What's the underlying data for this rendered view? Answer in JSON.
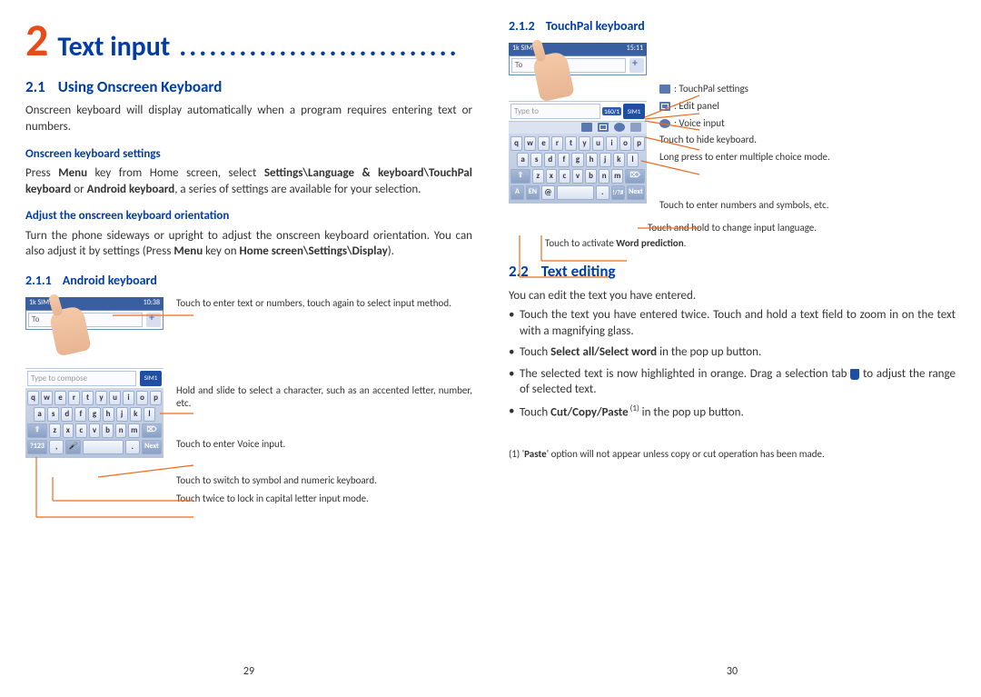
{
  "chapter": {
    "num": "2",
    "name": "Text input",
    "dots": "............................"
  },
  "s21": {
    "num": "2.1",
    "title": "Using Onscreen Keyboard",
    "p1": "Onscreen keyboard will display automatically when a program requires entering text or numbers."
  },
  "settings": {
    "h": "Onscreen keyboard settings",
    "p_a": "Press ",
    "p_b": "Menu",
    "p_c": " key from Home screen, select ",
    "p_d": "Settings\\Language & keyboard\\TouchPal keyboard",
    "p_e": " or ",
    "p_f": "Android keyboard",
    "p_g": ", a series of settings are available for your selection."
  },
  "orient": {
    "h": "Adjust the onscreen keyboard orientation",
    "p_a": "Turn the phone sideways or upright to adjust the onscreen keyboard orientation. You can also adjust it by settings (Press ",
    "p_b": "Menu",
    "p_c": " key on ",
    "p_d": "Home screen\\Settings\\Display",
    "p_e": ")."
  },
  "s211": {
    "num": "2.1.1",
    "title": "Android keyboard"
  },
  "s212": {
    "num": "2.1.2",
    "title": "TouchPal keyboard"
  },
  "s22": {
    "num": "2.2",
    "title": "Text editing",
    "intro": "You can edit the text you have entered."
  },
  "edit_b1": "Touch the text you have entered twice. Touch and hold a text field to zoom in on the text with a magnifying glass.",
  "edit_b2_a": "Touch ",
  "edit_b2_b": "Select all/Select word",
  "edit_b2_c": " in the pop up button.",
  "edit_b3_a": "The selected text is now highlighted in orange. Drag a selection tab ",
  "edit_b3_b": " to adjust the range of selected text.",
  "edit_b4_a": "Touch ",
  "edit_b4_b": "Cut/Copy/Paste",
  "edit_b4_c": " (1)",
  "edit_b4_d": " in the pop up button.",
  "foot_a": "(1)   '",
  "foot_b": "Paste",
  "foot_c": "' option will not appear unless copy or cut operation has been made.",
  "page_l": "29",
  "page_r": "30",
  "android_annot": {
    "a1": "Touch to enter text or numbers, touch again to select input method.",
    "a2": "Hold and slide to select a character, such as an accented letter, number, etc.",
    "a3": "Touch to enter Voice input.",
    "a4": "Touch to switch to symbol and numeric keyboard.",
    "a5": "Touch twice to lock in capital letter input mode."
  },
  "touchpal_annot": {
    "r1": ": TouchPal settings",
    "r2": ": Edit panel",
    "r3": ": Voice input",
    "r4": "Touch to hide keyboard.",
    "r5": "Long press to enter multiple choice mode.",
    "r6": "Touch to enter numbers and symbols, etc.",
    "b1": "Touch and hold to change input language.",
    "b2": "Touch to activate ",
    "b2b": "Word prediction",
    "b2c": "."
  },
  "mock": {
    "carrier": "1k SIM1",
    "time": "10:38",
    "time2": "15:11",
    "to": "To",
    "compose": "Type to compose",
    "compose2": "Type to",
    "sim": "SIM1",
    "count": "160/1",
    "row1": [
      "q",
      "w",
      "e",
      "r",
      "t",
      "y",
      "u",
      "i",
      "o",
      "p"
    ],
    "row2": [
      "a",
      "s",
      "d",
      "f",
      "g",
      "h",
      "j",
      "k",
      "l"
    ],
    "row3_shift": "⇧",
    "row3": [
      "z",
      "x",
      "c",
      "v",
      "b",
      "n",
      "m"
    ],
    "row3_del": "⌦",
    "row4": {
      "fn": "?123",
      "comma": ",",
      "mic": "🎤",
      "space": "",
      "dot": ".",
      "next": "Next"
    },
    "tp_row4": {
      "a": "A",
      "en": "EN",
      "at": "@",
      "space": "",
      "dot": ".",
      "sym": "!/?#",
      "next": "Next"
    }
  }
}
